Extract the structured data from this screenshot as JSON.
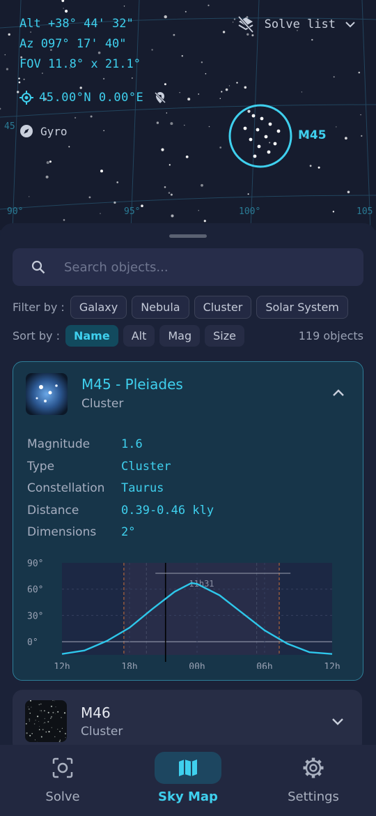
{
  "hud": {
    "alt": "Alt +38° 44' 32\"",
    "az": "Az  097° 17' 40\"",
    "fov": "FOV 11.8° x 21.1°",
    "location": "45.00°N  0.00°E",
    "gyro": "Gyro",
    "solve_list": "Solve list",
    "target_label": "M45",
    "ra_ticks": [
      "90°",
      "95°",
      "100°",
      "105"
    ],
    "dec_tick": "45"
  },
  "search": {
    "placeholder": "Search objects..."
  },
  "filter": {
    "label": "Filter by :",
    "options": [
      "Galaxy",
      "Nebula",
      "Cluster",
      "Solar System"
    ]
  },
  "sort": {
    "label": "Sort by :",
    "options": [
      "Name",
      "Alt",
      "Mag",
      "Size"
    ],
    "selected": "Name"
  },
  "object_count": "119 objects",
  "objects": [
    {
      "title": "M45 - Pleiades",
      "subtitle": "Cluster",
      "expanded": true,
      "details": [
        {
          "label": "Magnitude",
          "value": "1.6"
        },
        {
          "label": "Type",
          "value": "Cluster"
        },
        {
          "label": "Constellation",
          "value": "Taurus"
        },
        {
          "label": "Distance",
          "value": "0.39-0.46 kly"
        },
        {
          "label": "Dimensions",
          "value": "2°"
        }
      ]
    },
    {
      "title": "M46",
      "subtitle": "Cluster",
      "expanded": false
    }
  ],
  "chart_data": {
    "type": "line",
    "x_ticks": [
      "12h",
      "18h",
      "00h",
      "06h",
      "12h"
    ],
    "y_ticks": [
      "90°",
      "60°",
      "30°",
      "0°"
    ],
    "ylim": [
      -15,
      90
    ],
    "series": [
      {
        "values_hours": [
          12,
          14,
          16,
          18,
          20,
          22,
          23.5,
          24,
          26,
          28,
          30,
          32,
          34,
          36
        ],
        "alt_deg": [
          -14,
          -10,
          1,
          16,
          37,
          57,
          67,
          66,
          53,
          33,
          13,
          -2,
          -12,
          -14
        ]
      }
    ],
    "annotation": "11h31",
    "current_time_h": 21.2,
    "colors": {
      "curve": "#2ec7ea",
      "twilight": "#c7703a",
      "night_band": "#2a2e4a"
    }
  },
  "nav": {
    "items": [
      {
        "label": "Solve",
        "icon": "scan-icon"
      },
      {
        "label": "Sky Map",
        "icon": "map-icon"
      },
      {
        "label": "Settings",
        "icon": "gear-icon"
      }
    ],
    "active": "Sky Map"
  },
  "colors": {
    "accent": "#3fd0ee",
    "background": "#1b2238",
    "card_expanded": "#173549"
  }
}
